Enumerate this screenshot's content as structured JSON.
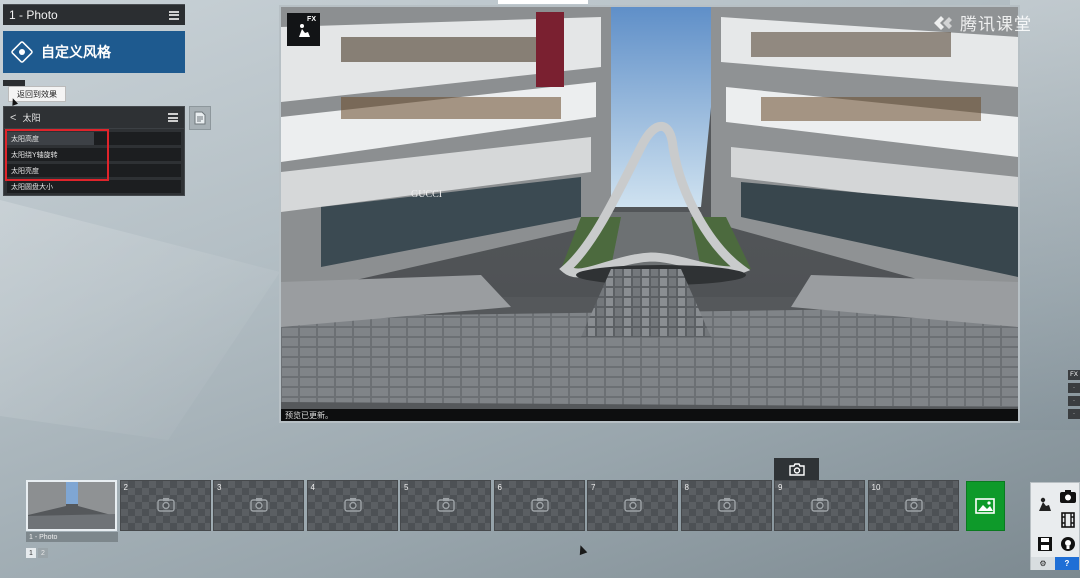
{
  "panel": {
    "title": "1 - Photo",
    "custom_style_label": "自定义风格",
    "return_tooltip": "返回到效果"
  },
  "sun_panel": {
    "title": "太阳",
    "rows": [
      {
        "label": "太阳高度",
        "level": 0.5
      },
      {
        "label": "太阳绕Y轴旋转",
        "level": 0.0
      },
      {
        "label": "太阳亮度",
        "level": 0.0
      },
      {
        "label": "太阳圆盘大小",
        "level": 0.0
      }
    ]
  },
  "preview": {
    "badge": "FX",
    "status": "预览已更新。"
  },
  "watermark": "腾讯课堂",
  "filmstrip": {
    "slots": [
      {
        "num": "1",
        "caption": "1 - Photo",
        "active": true
      },
      {
        "num": "2"
      },
      {
        "num": "3"
      },
      {
        "num": "4"
      },
      {
        "num": "5"
      },
      {
        "num": "6"
      },
      {
        "num": "7"
      },
      {
        "num": "8"
      },
      {
        "num": "9"
      },
      {
        "num": "10"
      }
    ],
    "pages": [
      "1",
      "2"
    ]
  },
  "tools": {
    "help_label": "?",
    "gear_label": "⚙"
  },
  "edge_buttons": [
    "FX",
    "·",
    "·",
    "·"
  ],
  "colors": {
    "accent_blue": "#1e5a8f",
    "highlight_red": "#e0242b",
    "gallery_green": "#0e9a2a",
    "help_blue": "#1f6fd6"
  }
}
